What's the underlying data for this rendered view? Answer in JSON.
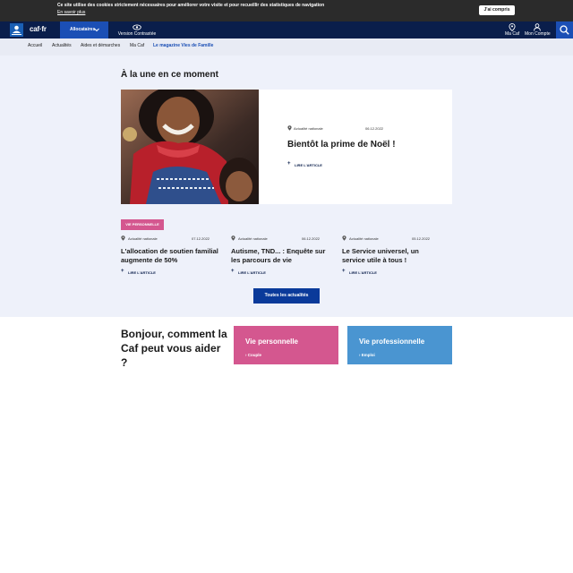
{
  "cookie": {
    "text": "Ce site utilise des cookies strictement nécessaires pour améliorer votre visite et pour recueillir des statistiques de navigation",
    "link": "En savoir plus",
    "button": "J'ai compris"
  },
  "header": {
    "logo_text": "caf·fr",
    "allocataires": "Allocataires",
    "contrast": "Version Contrastée",
    "ma_caf": "Ma Caf",
    "mon_compte": "Mon Compte"
  },
  "subnav": [
    "Accueil",
    "Actualités",
    "Aides et démarches",
    "Ma Caf",
    "Le magazine Vies de Famille"
  ],
  "news": {
    "section_title": "À la une en ce moment",
    "featured": {
      "category": "Actualité nationale",
      "date": "06.12.2022",
      "title": "Bientôt la prime de Noël !",
      "read": "LIRE L'ARTICLE"
    },
    "tag": "VIE PERSONNELLE",
    "cards": [
      {
        "category": "Actualité nationale",
        "date": "07.12.2022",
        "title": "L'allocation de soutien familial augmente de 50%",
        "read": "LIRE L'ARTICLE"
      },
      {
        "category": "Actualité nationale",
        "date": "06.12.2022",
        "title": "Autisme, TND... : Enquête sur les parcours de vie",
        "read": "LIRE L'ARTICLE"
      },
      {
        "category": "Actualité nationale",
        "date": "05.12.2022",
        "title": "Le Service universel, un service utile à tous !",
        "read": "LIRE L'ARTICLE"
      }
    ],
    "all_button": "Toutes les actualités"
  },
  "help": {
    "title": "Bonjour, comment la Caf peut vous aider ?",
    "perso": {
      "title": "Vie personnelle",
      "item": "› Couple"
    },
    "pro": {
      "title": "Vie professionnelle",
      "item": "› Emploi"
    }
  },
  "colors": {
    "header": "#0a1e4b",
    "accent_blue": "#1b4fb5",
    "pink": "#d4578f",
    "light_blue": "#4a95d1",
    "background": "#eef1fa"
  }
}
